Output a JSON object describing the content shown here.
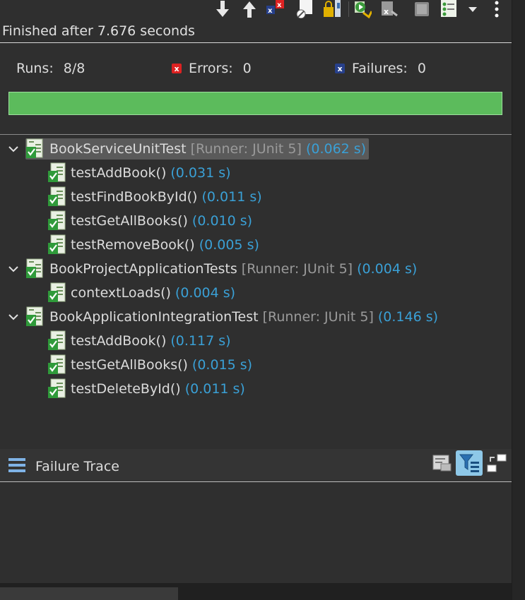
{
  "toolbar": {
    "buttons": [
      {
        "name": "next-failure-icon"
      },
      {
        "name": "previous-failure-icon"
      },
      {
        "name": "show-failures-only-icon"
      },
      {
        "name": "show-skipped-only-icon"
      },
      {
        "name": "scroll-lock-icon"
      },
      {
        "name": "rerun-test-icon"
      },
      {
        "name": "rerun-failed-first-icon"
      },
      {
        "name": "stop-icon"
      },
      {
        "name": "test-run-history-icon"
      },
      {
        "name": "view-menu-icon"
      }
    ]
  },
  "status": {
    "text": "Finished after 7.676 seconds"
  },
  "counters": {
    "runs_label": "Runs:",
    "runs_value": "8/8",
    "errors_label": "Errors:",
    "errors_value": "0",
    "failures_label": "Failures:",
    "failures_value": "0"
  },
  "progress": {
    "fraction": 1.0,
    "color": "#5cbb5c"
  },
  "tree": {
    "suites": [
      {
        "name": "BookServiceUnitTest",
        "runner": "[Runner: JUnit 5]",
        "time": "(0.062 s)",
        "tests": [
          {
            "name": "testAddBook()",
            "time": "(0.031 s)"
          },
          {
            "name": "testFindBookById()",
            "time": "(0.011 s)"
          },
          {
            "name": "testGetAllBooks()",
            "time": "(0.010 s)"
          },
          {
            "name": "testRemoveBook()",
            "time": "(0.005 s)"
          }
        ]
      },
      {
        "name": "BookProjectApplicationTests",
        "runner": "[Runner: JUnit 5]",
        "time": "(0.004 s)",
        "tests": [
          {
            "name": "contextLoads()",
            "time": "(0.004 s)"
          }
        ]
      },
      {
        "name": "BookApplicationIntegrationTest",
        "runner": "[Runner: JUnit 5]",
        "time": "(0.146 s)",
        "tests": [
          {
            "name": "testAddBook()",
            "time": "(0.117 s)"
          },
          {
            "name": "testGetAllBooks()",
            "time": "(0.015 s)"
          },
          {
            "name": "testDeleteById()",
            "time": "(0.011 s)"
          }
        ]
      }
    ]
  },
  "failure_trace": {
    "title": "Failure Trace"
  },
  "colors": {
    "time": "#3aa0d6",
    "runner": "#9a9a9a",
    "selected": "#5a5a5a"
  }
}
